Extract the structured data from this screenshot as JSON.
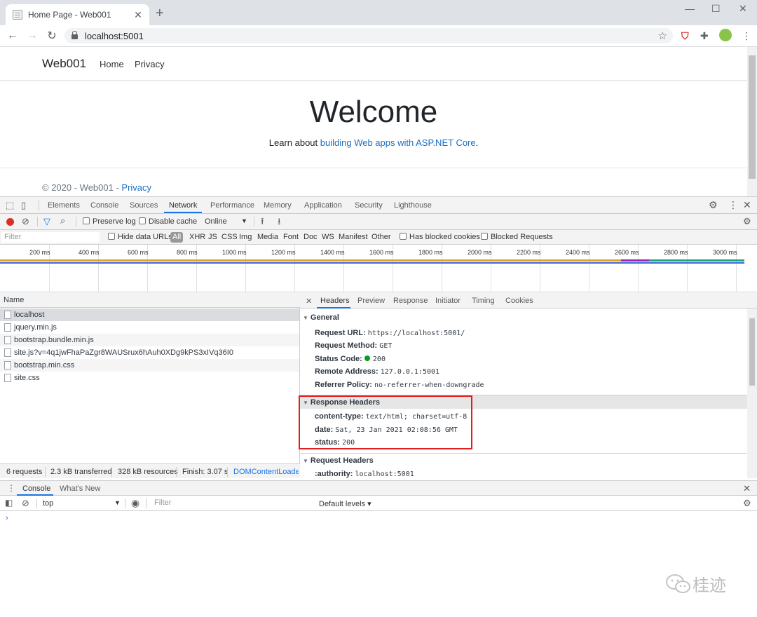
{
  "browser": {
    "tab_title": "Home Page - Web001",
    "url": "localhost:5001",
    "tab_close": "✕",
    "new_tab": "+",
    "minimize": "—",
    "maximize": "☐",
    "close": "✕"
  },
  "site": {
    "brand": "Web001",
    "nav": [
      "Home",
      "Privacy"
    ],
    "heading": "Welcome",
    "learn_prefix": "Learn about ",
    "learn_link": "building Web apps with ASP.NET Core",
    "learn_suffix": ".",
    "footer_text": "© 2020 - Web001 - ",
    "footer_link": "Privacy"
  },
  "devtools": {
    "tabs": [
      "Elements",
      "Console",
      "Sources",
      "Network",
      "Performance",
      "Memory",
      "Application",
      "Security",
      "Lighthouse"
    ],
    "active_tab": "Network",
    "toolbar": {
      "preserve_log": "Preserve log",
      "disable_cache": "Disable cache",
      "throttle": "Online"
    },
    "filter": {
      "placeholder": "Filter",
      "hide_data_urls": "Hide data URLs",
      "types": [
        "All",
        "XHR",
        "JS",
        "CSS",
        "Img",
        "Media",
        "Font",
        "Doc",
        "WS",
        "Manifest",
        "Other"
      ],
      "has_blocked_cookies": "Has blocked cookies",
      "blocked_requests": "Blocked Requests"
    },
    "overview_ticks": [
      "200 ms",
      "400 ms",
      "600 ms",
      "800 ms",
      "1000 ms",
      "1200 ms",
      "1400 ms",
      "1600 ms",
      "1800 ms",
      "2000 ms",
      "2200 ms",
      "2400 ms",
      "2600 ms",
      "2800 ms",
      "3000 ms"
    ],
    "requests": {
      "header": "Name",
      "rows": [
        "localhost",
        "jquery.min.js",
        "bootstrap.bundle.min.js",
        "site.js?v=4q1jwFhaPaZgr8WAUSrux6hAuh0XDg9kPS3xIVq36I0",
        "bootstrap.min.css",
        "site.css"
      ],
      "summary": [
        "6 requests",
        "2.3 kB transferred",
        "328 kB resources",
        "Finish: 3.07 s",
        "DOMContentLoadec"
      ]
    },
    "detail_tabs": [
      "Headers",
      "Preview",
      "Response",
      "Initiator",
      "Timing",
      "Cookies"
    ],
    "general": {
      "title": "General",
      "items": [
        {
          "k": "Request URL:",
          "v": "https://localhost:5001/"
        },
        {
          "k": "Request Method:",
          "v": "GET"
        },
        {
          "k": "Status Code:",
          "v": "200"
        },
        {
          "k": "Remote Address:",
          "v": "127.0.0.1:5001"
        },
        {
          "k": "Referrer Policy:",
          "v": "no-referrer-when-downgrade"
        }
      ]
    },
    "response_headers": {
      "title": "Response Headers",
      "items": [
        {
          "k": "content-type:",
          "v": "text/html; charset=utf-8"
        },
        {
          "k": "date:",
          "v": "Sat, 23 Jan 2021 02:08:56 GMT"
        },
        {
          "k": "status:",
          "v": "200"
        }
      ]
    },
    "request_headers": {
      "title": "Request Headers",
      "items": [
        {
          "k": ":authority:",
          "v": "localhost:5001"
        }
      ]
    },
    "drawer": {
      "tabs": [
        "Console",
        "What's New"
      ],
      "context": "top",
      "filter_placeholder": "Filter",
      "levels": "Default levels ▾",
      "prompt": "›"
    }
  },
  "watermark": "桂迹",
  "colors": {
    "record": "#d93025",
    "accent": "#1a73e8",
    "link": "#1b6ec2",
    "highlight": "#e02020",
    "status_ok": "#0a9d23"
  }
}
